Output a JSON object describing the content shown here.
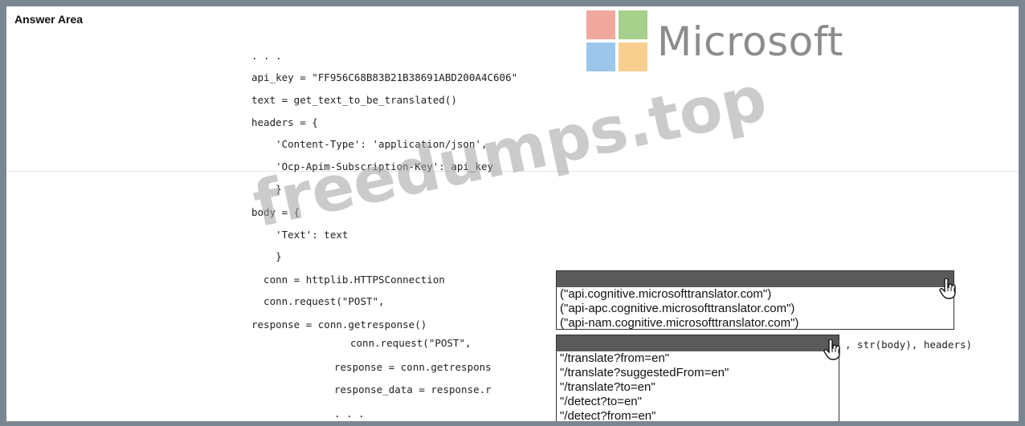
{
  "header": {
    "title": "Answer Area"
  },
  "logo": {
    "text": "Microsoft",
    "colors": {
      "red": "#f0a89c",
      "green": "#a7d08c",
      "blue": "#9cc7ea",
      "yellow": "#f8cf8f"
    }
  },
  "watermark": {
    "text": "freedumps.top"
  },
  "code": {
    "lines": [
      ". . .",
      "api_key = \"FF956C68B83B21B38691ABD200A4C606\"",
      "text = get_text_to_be_translated()",
      "headers = {",
      "    'Content-Type': 'application/json',",
      "    'Ocp-Apim-Subscription-Key': api_key",
      "    }",
      "body = {",
      "    'Text': text",
      "    }",
      "  conn = httplib.HTTPSConnection",
      "  conn.request(\"POST\",",
      "response = conn.getresponse()",
      "conn.request(\"POST\",",
      "response = conn.getrespons",
      "response_data = response.r",
      ". . .",
      ", str(body), headers)"
    ]
  },
  "dropdown1": {
    "options": [
      "(\"api.cognitive.microsofttranslator.com\")",
      "(\"api-apc.cognitive.microsofttranslator.com\")",
      "(\"api-nam.cognitive.microsofttranslator.com\")"
    ]
  },
  "dropdown2": {
    "options": [
      "\"/translate?from=en\"",
      "\"/translate?suggestedFrom=en\"",
      "\"/translate?to=en\"",
      "\"/detect?to=en\"",
      "\"/detect?from=en\""
    ]
  },
  "icons": {
    "cursor": "hand-pointer-icon"
  }
}
